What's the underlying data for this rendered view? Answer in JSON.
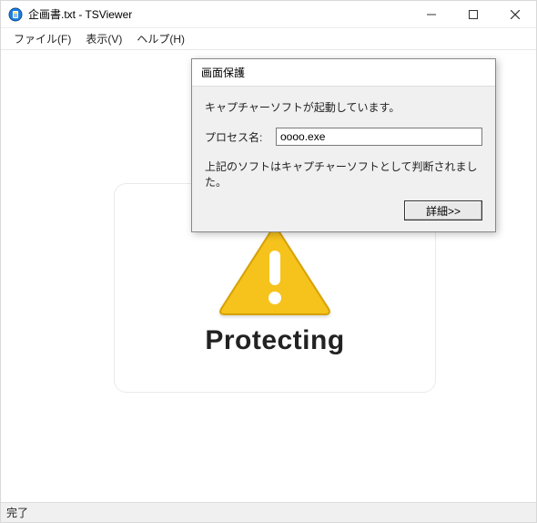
{
  "window": {
    "title": "企画書.txt - TSViewer",
    "menus": {
      "file": "ファイル(F)",
      "view": "表示(V)",
      "help": "ヘルプ(H)"
    },
    "status": "完了"
  },
  "protect": {
    "label": "Protecting"
  },
  "dialog": {
    "title": "画面保護",
    "msg_running": "キャプチャーソフトが起動しています。",
    "process_label": "プロセス名:",
    "process_value": "oooo.exe",
    "msg_detected": "上記のソフトはキャプチャーソフトとして判断されました。",
    "details_button": "詳細>>"
  },
  "icons": {
    "app": "app-icon",
    "minimize": "minimize-icon",
    "maximize": "maximize-icon",
    "close": "close-icon",
    "warning": "warning-triangle-icon"
  },
  "colors": {
    "warning_fill": "#f6c21b",
    "warning_stroke": "#d6a100"
  }
}
